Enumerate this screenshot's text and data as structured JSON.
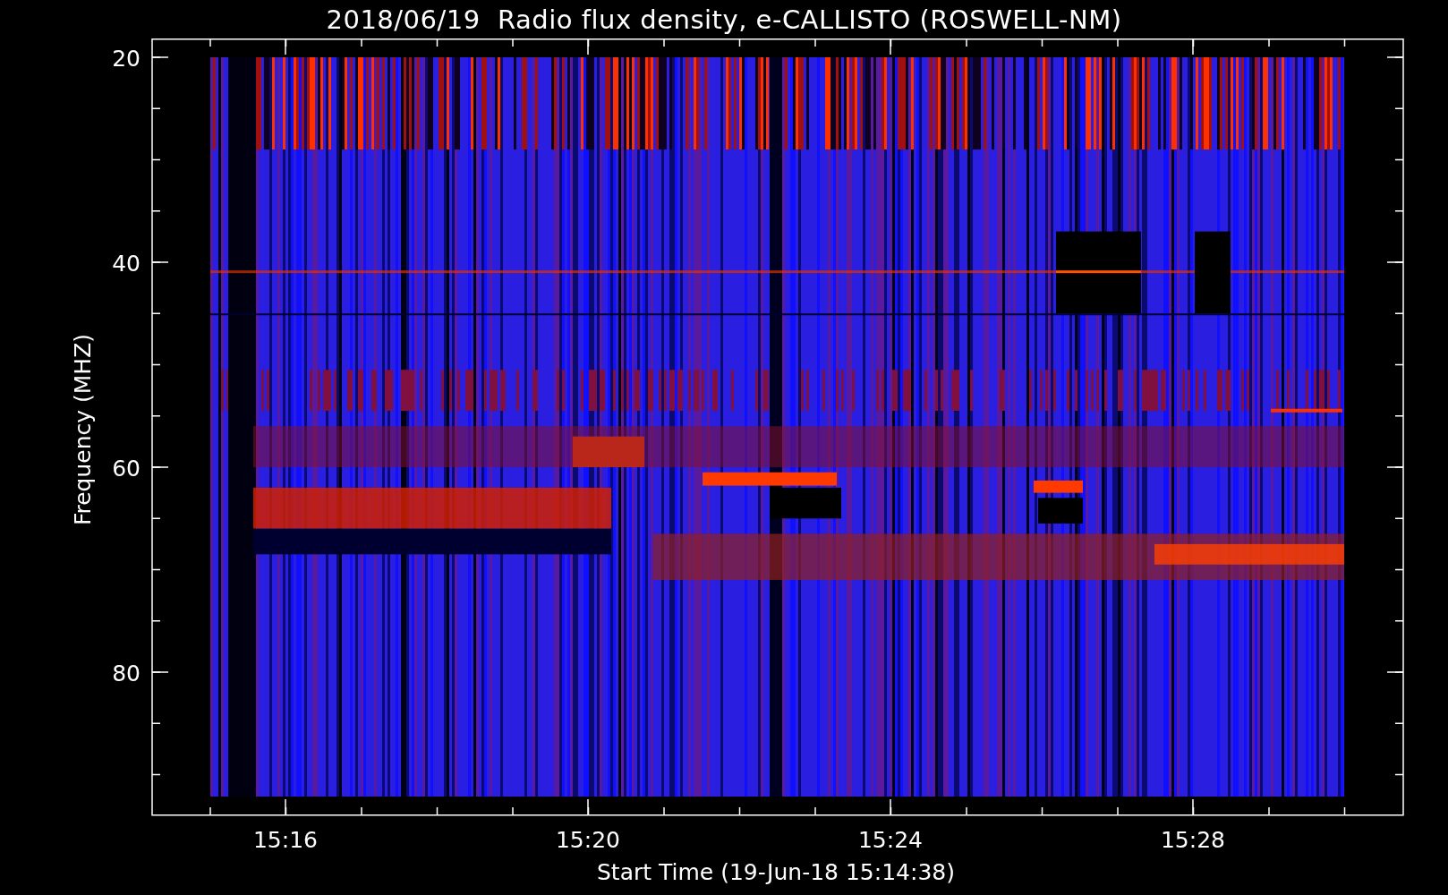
{
  "title": "2018/06/19  Radio flux density, e-CALLISTO (ROSWELL-NM)",
  "y_axis": {
    "label": "Frequency (MHZ)",
    "ticks": [
      "20",
      "40",
      "60",
      "80"
    ]
  },
  "x_axis": {
    "label": "Start Time (19-Jun-18 15:14:38)",
    "ticks": [
      "15:16",
      "15:20",
      "15:24",
      "15:28"
    ]
  }
}
